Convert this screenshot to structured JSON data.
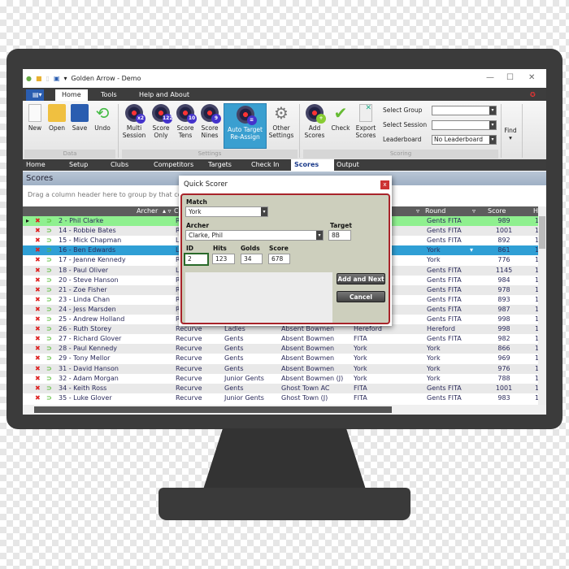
{
  "window": {
    "title": "Golden Arrow - Demo",
    "minimize": "—",
    "maximize": "☐",
    "close": "✕"
  },
  "ribbon_tabs": [
    {
      "label": "Home"
    },
    {
      "label": "Tools"
    },
    {
      "label": "Help and About"
    }
  ],
  "ribbon": {
    "data_group": {
      "label": "Data",
      "buttons": [
        {
          "label": "New"
        },
        {
          "label": "Open"
        },
        {
          "label": "Save"
        },
        {
          "label": "Undo"
        }
      ]
    },
    "settings_group": {
      "label": "Settings",
      "buttons": [
        {
          "label": "Multi Session",
          "badge": "x2"
        },
        {
          "label": "Score Only",
          "badge": "122"
        },
        {
          "label": "Score Tens",
          "badge": "10"
        },
        {
          "label": "Score Nines",
          "badge": "9"
        },
        {
          "label": "Auto Target Re-Assign",
          "badge": "≡"
        },
        {
          "label": "Other Settings"
        }
      ]
    },
    "scoring_group": {
      "label": "Scoring",
      "buttons": [
        {
          "label": "Add Scores"
        },
        {
          "label": "Check"
        },
        {
          "label": "Export Scores"
        }
      ],
      "select_group_label": "Select Group",
      "select_group_value": "",
      "select_session_label": "Select Session",
      "select_session_value": "",
      "leaderboard_label": "Leaderboard",
      "leaderboard_value": "No Leaderboard"
    },
    "find_label": "Find"
  },
  "nav_tabs": [
    {
      "label": "Home"
    },
    {
      "label": "Setup"
    },
    {
      "label": "Clubs"
    },
    {
      "label": "Competitors"
    },
    {
      "label": "Targets"
    },
    {
      "label": "Check In"
    },
    {
      "label": "Scores",
      "active": true
    },
    {
      "label": "Output"
    }
  ],
  "panel": {
    "title": "Scores",
    "group_hint": "Drag a column header here to group by that column"
  },
  "columns": {
    "archer": "Archer",
    "c2": "C",
    "round": "Round",
    "score": "Score",
    "h": "H"
  },
  "rows": [
    {
      "archer": "2 - Phil Clarke",
      "bow": "R",
      "class": "",
      "club": "",
      "col5": "",
      "round": "Gents FITA",
      "score": "989",
      "h": "1",
      "state": "green"
    },
    {
      "archer": "14 - Robbie Bates",
      "bow": "R",
      "class": "",
      "club": "",
      "col5": "",
      "round": "Gents FITA",
      "score": "1001",
      "h": "1"
    },
    {
      "archer": "15 - Mick Chapman",
      "bow": "L",
      "class": "",
      "club": "",
      "col5": "",
      "round": "Gents FITA",
      "score": "892",
      "h": "1"
    },
    {
      "archer": "16 - Ben Edwards",
      "bow": "L",
      "class": "",
      "club": "",
      "col5": "",
      "round": "York",
      "score": "861",
      "h": "1",
      "state": "selected"
    },
    {
      "archer": "17 - Jeanne Kennedy",
      "bow": "R",
      "class": "",
      "club": "",
      "col5": "",
      "round": "York",
      "score": "776",
      "h": "1"
    },
    {
      "archer": "18 - Paul Oliver",
      "bow": "L",
      "class": "",
      "club": "",
      "col5": "",
      "round": "Gents FITA",
      "score": "1145",
      "h": "1"
    },
    {
      "archer": "20 - Steve Hanson",
      "bow": "R",
      "class": "",
      "club": "",
      "col5": "",
      "round": "Gents FITA",
      "score": "984",
      "h": "1"
    },
    {
      "archer": "21 - Zoe Fisher",
      "bow": "R",
      "class": "",
      "club": "",
      "col5": "",
      "round": "Gents FITA",
      "score": "978",
      "h": "1"
    },
    {
      "archer": "23 - Linda Chan",
      "bow": "R",
      "class": "",
      "club": "",
      "col5": "",
      "round": "Gents FITA",
      "score": "893",
      "h": "1"
    },
    {
      "archer": "24 - Jess Marsden",
      "bow": "R",
      "class": "",
      "club": "",
      "col5": "",
      "round": "Gents FITA",
      "score": "987",
      "h": "1"
    },
    {
      "archer": "25 - Andrew Holland",
      "bow": "R",
      "class": "",
      "club": "",
      "col5": "",
      "round": "Gents FITA",
      "score": "998",
      "h": "1"
    },
    {
      "archer": "26 - Ruth Storey",
      "bow": "Recurve",
      "class": "Ladies",
      "club": "Absent Bowmen",
      "col5": "Hereford",
      "round": "Hereford",
      "score": "998",
      "h": "1"
    },
    {
      "archer": "27 - Richard Glover",
      "bow": "Recurve",
      "class": "Gents",
      "club": "Absent Bowmen",
      "col5": "FITA",
      "round": "Gents FITA",
      "score": "982",
      "h": "1"
    },
    {
      "archer": "28 - Paul Kennedy",
      "bow": "Recurve",
      "class": "Gents",
      "club": "Absent Bowmen",
      "col5": "York",
      "round": "York",
      "score": "866",
      "h": "1"
    },
    {
      "archer": "29 - Tony Mellor",
      "bow": "Recurve",
      "class": "Gents",
      "club": "Absent Bowmen",
      "col5": "York",
      "round": "York",
      "score": "969",
      "h": "1"
    },
    {
      "archer": "31 - David Hanson",
      "bow": "Recurve",
      "class": "Gents",
      "club": "Absent Bowmen",
      "col5": "York",
      "round": "York",
      "score": "976",
      "h": "1"
    },
    {
      "archer": "32 - Adam Morgan",
      "bow": "Recurve",
      "class": "Junior Gents",
      "club": "Absent Bowmen (J)",
      "col5": "York",
      "round": "York",
      "score": "788",
      "h": "1"
    },
    {
      "archer": "34 - Keith Ross",
      "bow": "Recurve",
      "class": "Gents",
      "club": "Ghost Town AC",
      "col5": "FITA",
      "round": "Gents FITA",
      "score": "1001",
      "h": "1"
    },
    {
      "archer": "35 - Luke Glover",
      "bow": "Recurve",
      "class": "Junior Gents",
      "club": "Ghost Town (J)",
      "col5": "FITA",
      "round": "Gents FITA",
      "score": "983",
      "h": "1"
    }
  ],
  "dialog": {
    "title": "Quick Scorer",
    "close": "x",
    "match_label": "Match",
    "match_value": "York",
    "archer_label": "Archer",
    "archer_value": "Clarke, Phil",
    "target_label": "Target",
    "target_value": "8B",
    "id_label": "ID",
    "id_value": "2",
    "hits_label": "Hits",
    "hits_value": "123",
    "golds_label": "Golds",
    "golds_value": "34",
    "score_label": "Score",
    "score_value": "678",
    "add_next": "Add and Next",
    "cancel": "Cancel"
  },
  "colors": {
    "accent": "#2f9fd5",
    "green_row": "#8ff08f",
    "dialog_border": "#a8242a"
  }
}
